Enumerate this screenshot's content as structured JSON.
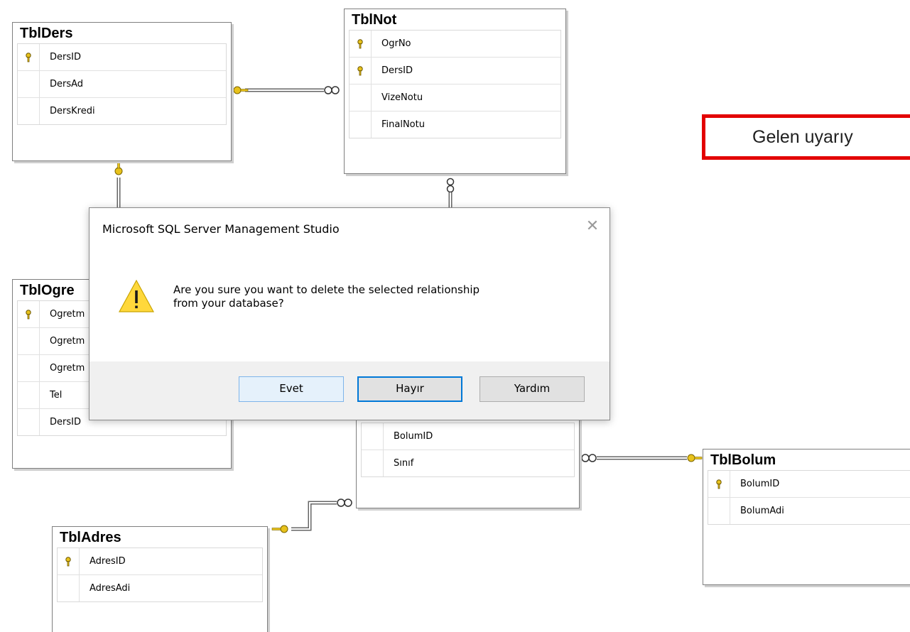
{
  "tables": {
    "ders": {
      "name": "TblDers",
      "columns": [
        {
          "name": "DersID",
          "key": true
        },
        {
          "name": "DersAd",
          "key": false
        },
        {
          "name": "DersKredi",
          "key": false
        }
      ]
    },
    "not": {
      "name": "TblNot",
      "columns": [
        {
          "name": "OgrNo",
          "key": true
        },
        {
          "name": "DersID",
          "key": true
        },
        {
          "name": "VizeNotu",
          "key": false
        },
        {
          "name": "FinalNotu",
          "key": false
        }
      ]
    },
    "ogretmen": {
      "name": "TblOgre",
      "columns": [
        {
          "name": "Ogretm",
          "key": true
        },
        {
          "name": "Ogretm",
          "key": false
        },
        {
          "name": "Ogretm",
          "key": false
        },
        {
          "name": "Tel",
          "key": false
        },
        {
          "name": "DersID",
          "key": false
        }
      ]
    },
    "ogrenci": {
      "name": "",
      "columns": [
        {
          "name": "BolumID",
          "key": false
        },
        {
          "name": "Sınıf",
          "key": false
        }
      ]
    },
    "bolum": {
      "name": "TblBolum",
      "columns": [
        {
          "name": "BolumID",
          "key": true
        },
        {
          "name": "BolumAdi",
          "key": false
        }
      ]
    },
    "adres": {
      "name": "TblAdres",
      "columns": [
        {
          "name": "AdresID",
          "key": true
        },
        {
          "name": "AdresAdi",
          "key": false
        }
      ]
    }
  },
  "callout": {
    "text": "Gelen uyarıy"
  },
  "dialog": {
    "title": "Microsoft SQL Server Management Studio",
    "close_glyph": "✕",
    "message_line1": "Are you sure you want to delete the selected relationship",
    "message_line2": "from your database?",
    "buttons": {
      "yes": "Evet",
      "no": "Hayır",
      "help": "Yardım"
    }
  },
  "colors": {
    "key_icon": "#e8c21c",
    "warning": "#ffd83b",
    "callout_border": "#e30000",
    "default_button": "#0078d7"
  }
}
